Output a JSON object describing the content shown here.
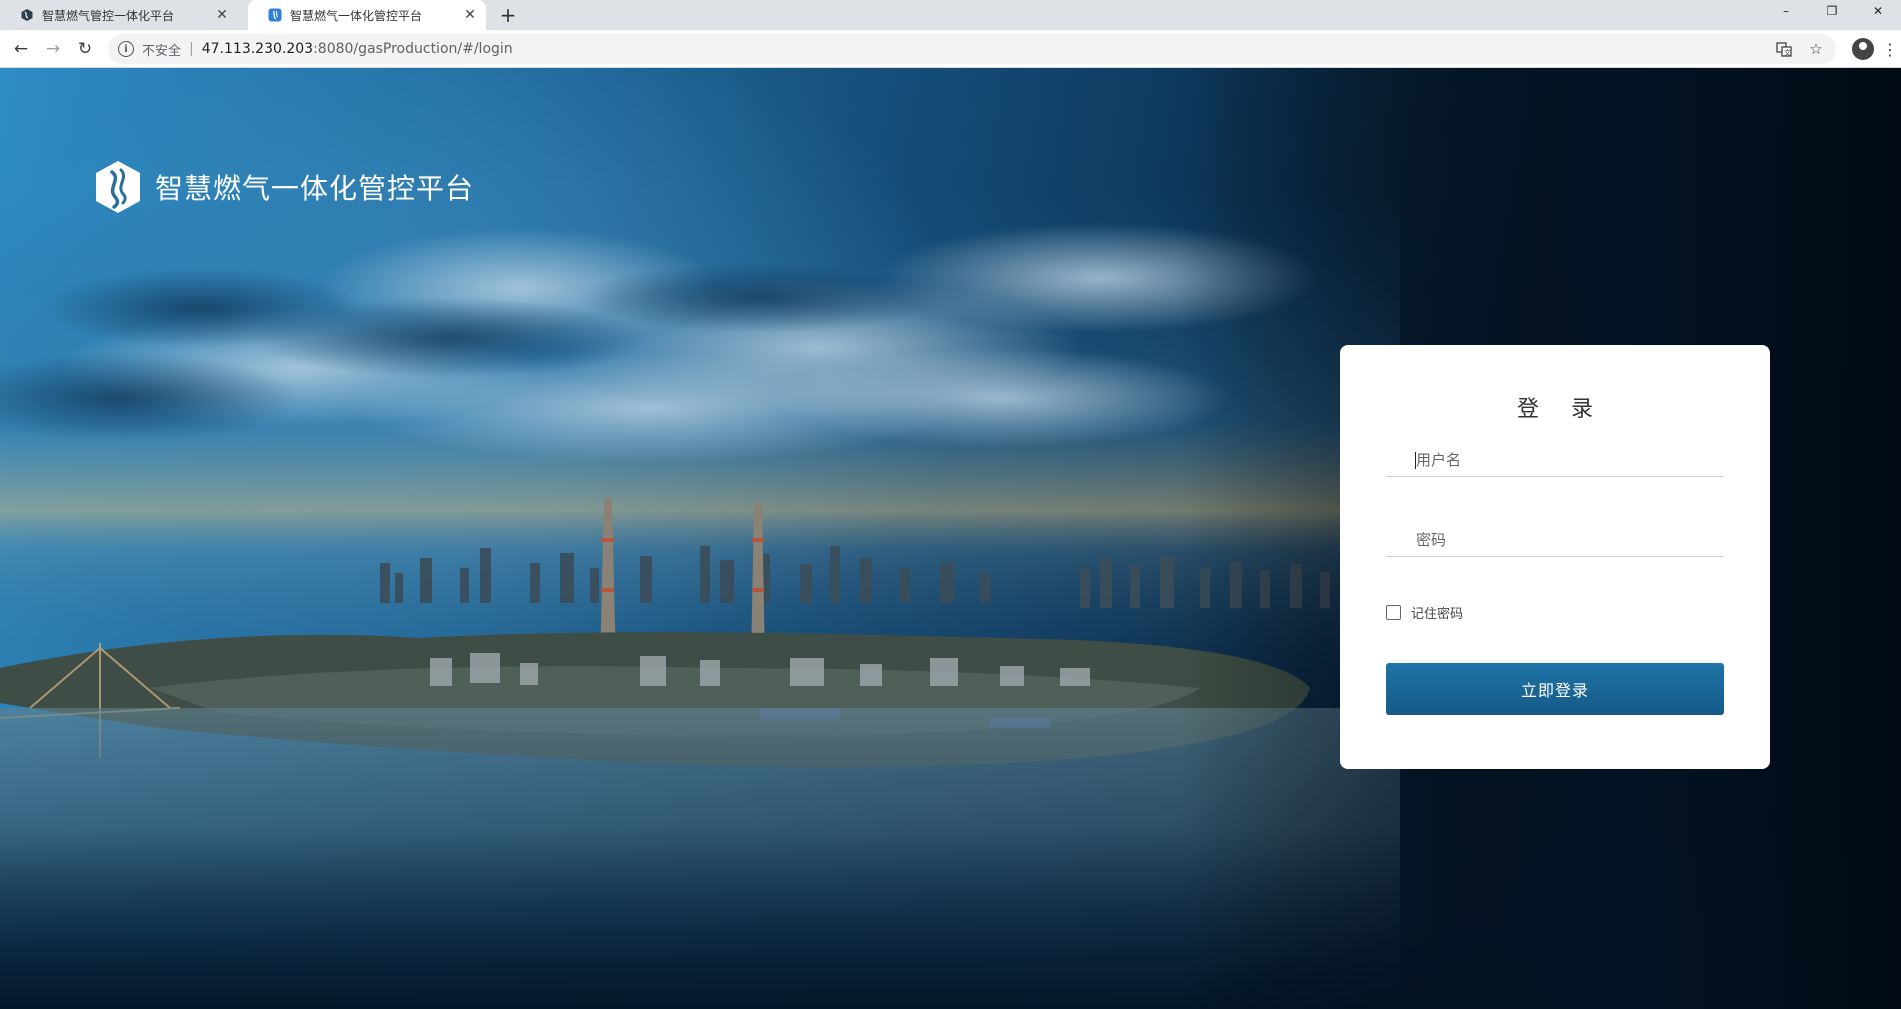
{
  "browser": {
    "tabs": [
      {
        "title": "智慧燃气管控一体化平台",
        "active": false
      },
      {
        "title": "智慧燃气一体化管控平台",
        "active": true
      }
    ],
    "new_tab_icon": "plus-icon",
    "window_controls": {
      "minimize": "–",
      "restore": "❐",
      "close": "✕"
    }
  },
  "toolbar": {
    "security_label": "不安全",
    "url_host": "47.113.230.203",
    "url_rest": ":8080/gasProduction/#/login"
  },
  "brand": {
    "name": "智慧燃气一体化管控平台"
  },
  "login": {
    "title": "登录",
    "username_placeholder": "用户名",
    "password_placeholder": "密码",
    "remember_label": "记住密码",
    "submit_label": "立即登录"
  },
  "colors": {
    "button": "#1a6798",
    "card": "#ffffff",
    "background_dark": "#030e19",
    "background_light": "#2f8cc3"
  }
}
